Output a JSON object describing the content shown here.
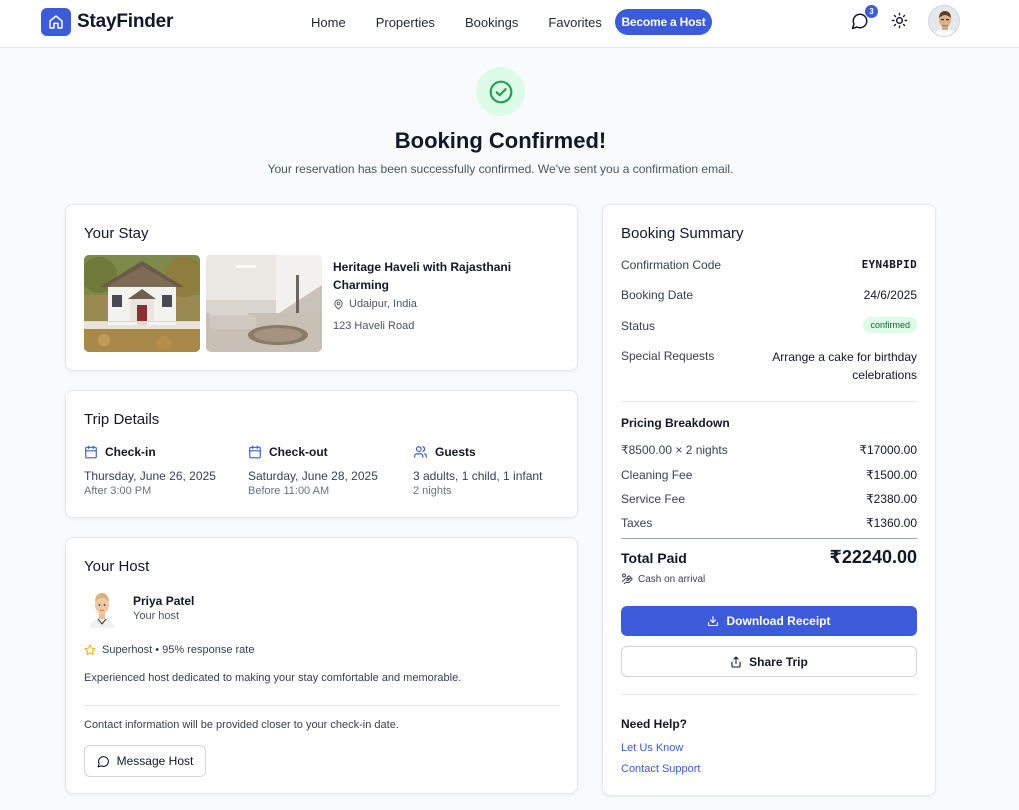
{
  "nav": {
    "brand": "StayFinder",
    "links": [
      "Home",
      "Properties",
      "Bookings",
      "Favorites"
    ],
    "host_button": "Become a Host",
    "notification_count": "3",
    "accent": "#3b5bdb"
  },
  "hero": {
    "title": "Booking Confirmed!",
    "subtitle": "Your reservation has been successfully confirmed. We've sent you a confirmation email."
  },
  "stay": {
    "title": "Your Stay",
    "property_name": "Heritage Haveli with Rajasthani Charming",
    "location": "Udaipur, India",
    "address": "123 Haveli Road"
  },
  "trip": {
    "title": "Trip Details",
    "checkin_label": "Check-in",
    "checkin_date": "Thursday, June 26, 2025",
    "checkin_time": "After 3:00 PM",
    "checkout_label": "Check-out",
    "checkout_date": "Saturday, June 28, 2025",
    "checkout_time": "Before 11:00 AM",
    "guests_label": "Guests",
    "guests_value": "3 adults, 1 child, 1 infant",
    "nights": "2 nights"
  },
  "host": {
    "title": "Your Host",
    "name": "Priya Patel",
    "role": "Your host",
    "superhost": "Superhost • 95% response rate",
    "description": "Experienced host dedicated to making your stay comfortable and memorable.",
    "contact_note": "Contact information will be provided closer to your check-in date.",
    "message_button": "Message Host"
  },
  "summary": {
    "title": "Booking Summary",
    "confirmation_label": "Confirmation Code",
    "confirmation_code": "EYN4BPID",
    "booking_date_label": "Booking Date",
    "booking_date": "24/6/2025",
    "status_label": "Status",
    "status": "confirmed",
    "requests_label": "Special Requests",
    "requests": "Arrange a cake for birthday celebrations",
    "pricing_title": "Pricing Breakdown",
    "pricing": [
      {
        "label": "₹8500.00 × 2 nights",
        "value": "₹17000.00"
      },
      {
        "label": "Cleaning Fee",
        "value": "₹1500.00"
      },
      {
        "label": "Service Fee",
        "value": "₹2380.00"
      },
      {
        "label": "Taxes",
        "value": "₹1360.00"
      }
    ],
    "total_label": "Total Paid",
    "total_value": "₹22240.00",
    "payment_method": "Cash on arrival",
    "download_button": "Download Receipt",
    "share_button": "Share Trip",
    "help_title": "Need Help?",
    "help_link_1": "Let Us Know",
    "help_link_2": "Contact Support"
  }
}
